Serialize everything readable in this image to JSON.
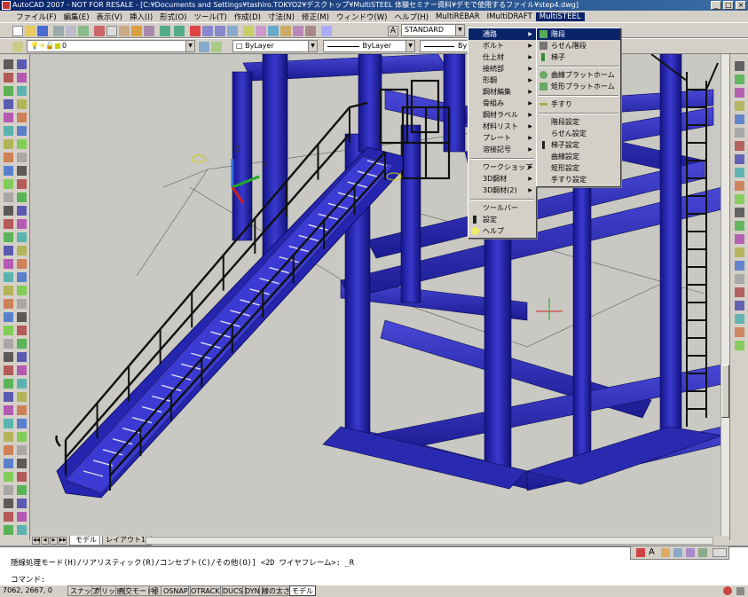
{
  "window": {
    "title": "AutoCAD 2007 - NOT FOR RESALE - [C:¥Documents and Settings¥tashiro.TOKYO2¥デスクトップ¥MultiSTEEL 体験セミナー資料¥デモで使用するファイル¥step4.dwg]",
    "min": "_",
    "max": "□",
    "close": "×"
  },
  "menubar": {
    "items": [
      "ファイル(F)",
      "編集(E)",
      "表示(V)",
      "挿入(I)",
      "形式(O)",
      "ツール(T)",
      "作成(D)",
      "寸法(N)",
      "修正(M)",
      "ウィンドウ(W)",
      "ヘルプ(H)",
      "MultiREBAR",
      "IMultiDRAFT",
      "MultiSTEEL"
    ]
  },
  "toolbar": {
    "style_combo": "STANDARD",
    "layer_combo": "0",
    "color_combo": "□ ByLayer",
    "linetype_combo": "ByLayer",
    "lineweight_combo": "ByLa"
  },
  "tabs": {
    "model": "モデル",
    "layout": "レイアウト1"
  },
  "command": {
    "line1": "隠線処理モード(H)/リアリスティック(R)/コンセプト(C)/その他(O)] <2D ワイヤフレーム>: _R",
    "line2": "コマンド:"
  },
  "status": {
    "coords": "7062, 2667, 0",
    "buttons": [
      "スナップ",
      "グリッド",
      "直交モード",
      "極",
      "OSNAP",
      "OTRACK",
      "DUCS",
      "DYN",
      "線の太さ",
      "モデル"
    ],
    "active": "モデル"
  },
  "main_menu": {
    "items": [
      {
        "label": "通路",
        "sub": true
      },
      {
        "label": "ボルト",
        "sub": true
      },
      {
        "label": "仕上材",
        "sub": true
      },
      {
        "label": "接続部",
        "sub": true
      },
      {
        "label": "形鋼",
        "sub": true
      },
      {
        "label": "鋼材編集",
        "sub": true
      },
      {
        "label": "骨組み",
        "sub": true
      },
      {
        "label": "鋼材ラベル",
        "sub": true
      },
      {
        "label": "材料リスト",
        "sub": true
      },
      {
        "label": "プレート",
        "sub": true
      },
      {
        "label": "溶接記号",
        "sub": true
      },
      {
        "label": "ワークショップ",
        "sub": true
      },
      {
        "label": "3D鋼材",
        "sub": true
      },
      {
        "label": "3D鋼材(2)",
        "sub": true
      },
      {
        "label": "ツールバー",
        "sub": false
      },
      {
        "label": "設定",
        "sub": false
      },
      {
        "label": "ヘルプ",
        "sub": false
      }
    ]
  },
  "sub_menu": {
    "items": [
      {
        "label": "階段"
      },
      {
        "label": "らせん階段"
      },
      {
        "label": "梯子"
      },
      {
        "label": "曲線プラットホーム"
      },
      {
        "label": "矩形プラットホーム"
      },
      {
        "label": "手すり"
      },
      {
        "label": "階段設定"
      },
      {
        "label": "らせん設定"
      },
      {
        "label": "梯子設定"
      },
      {
        "label": "曲線設定"
      },
      {
        "label": "矩形設定"
      },
      {
        "label": "手すり設定"
      }
    ]
  },
  "colors": {
    "steel": "#2323b8",
    "steel_dark": "#0f0f70",
    "background": "#c9c8c2",
    "highlight": "#0a246a"
  },
  "axis": {
    "z": "Z",
    "y": "Y"
  }
}
